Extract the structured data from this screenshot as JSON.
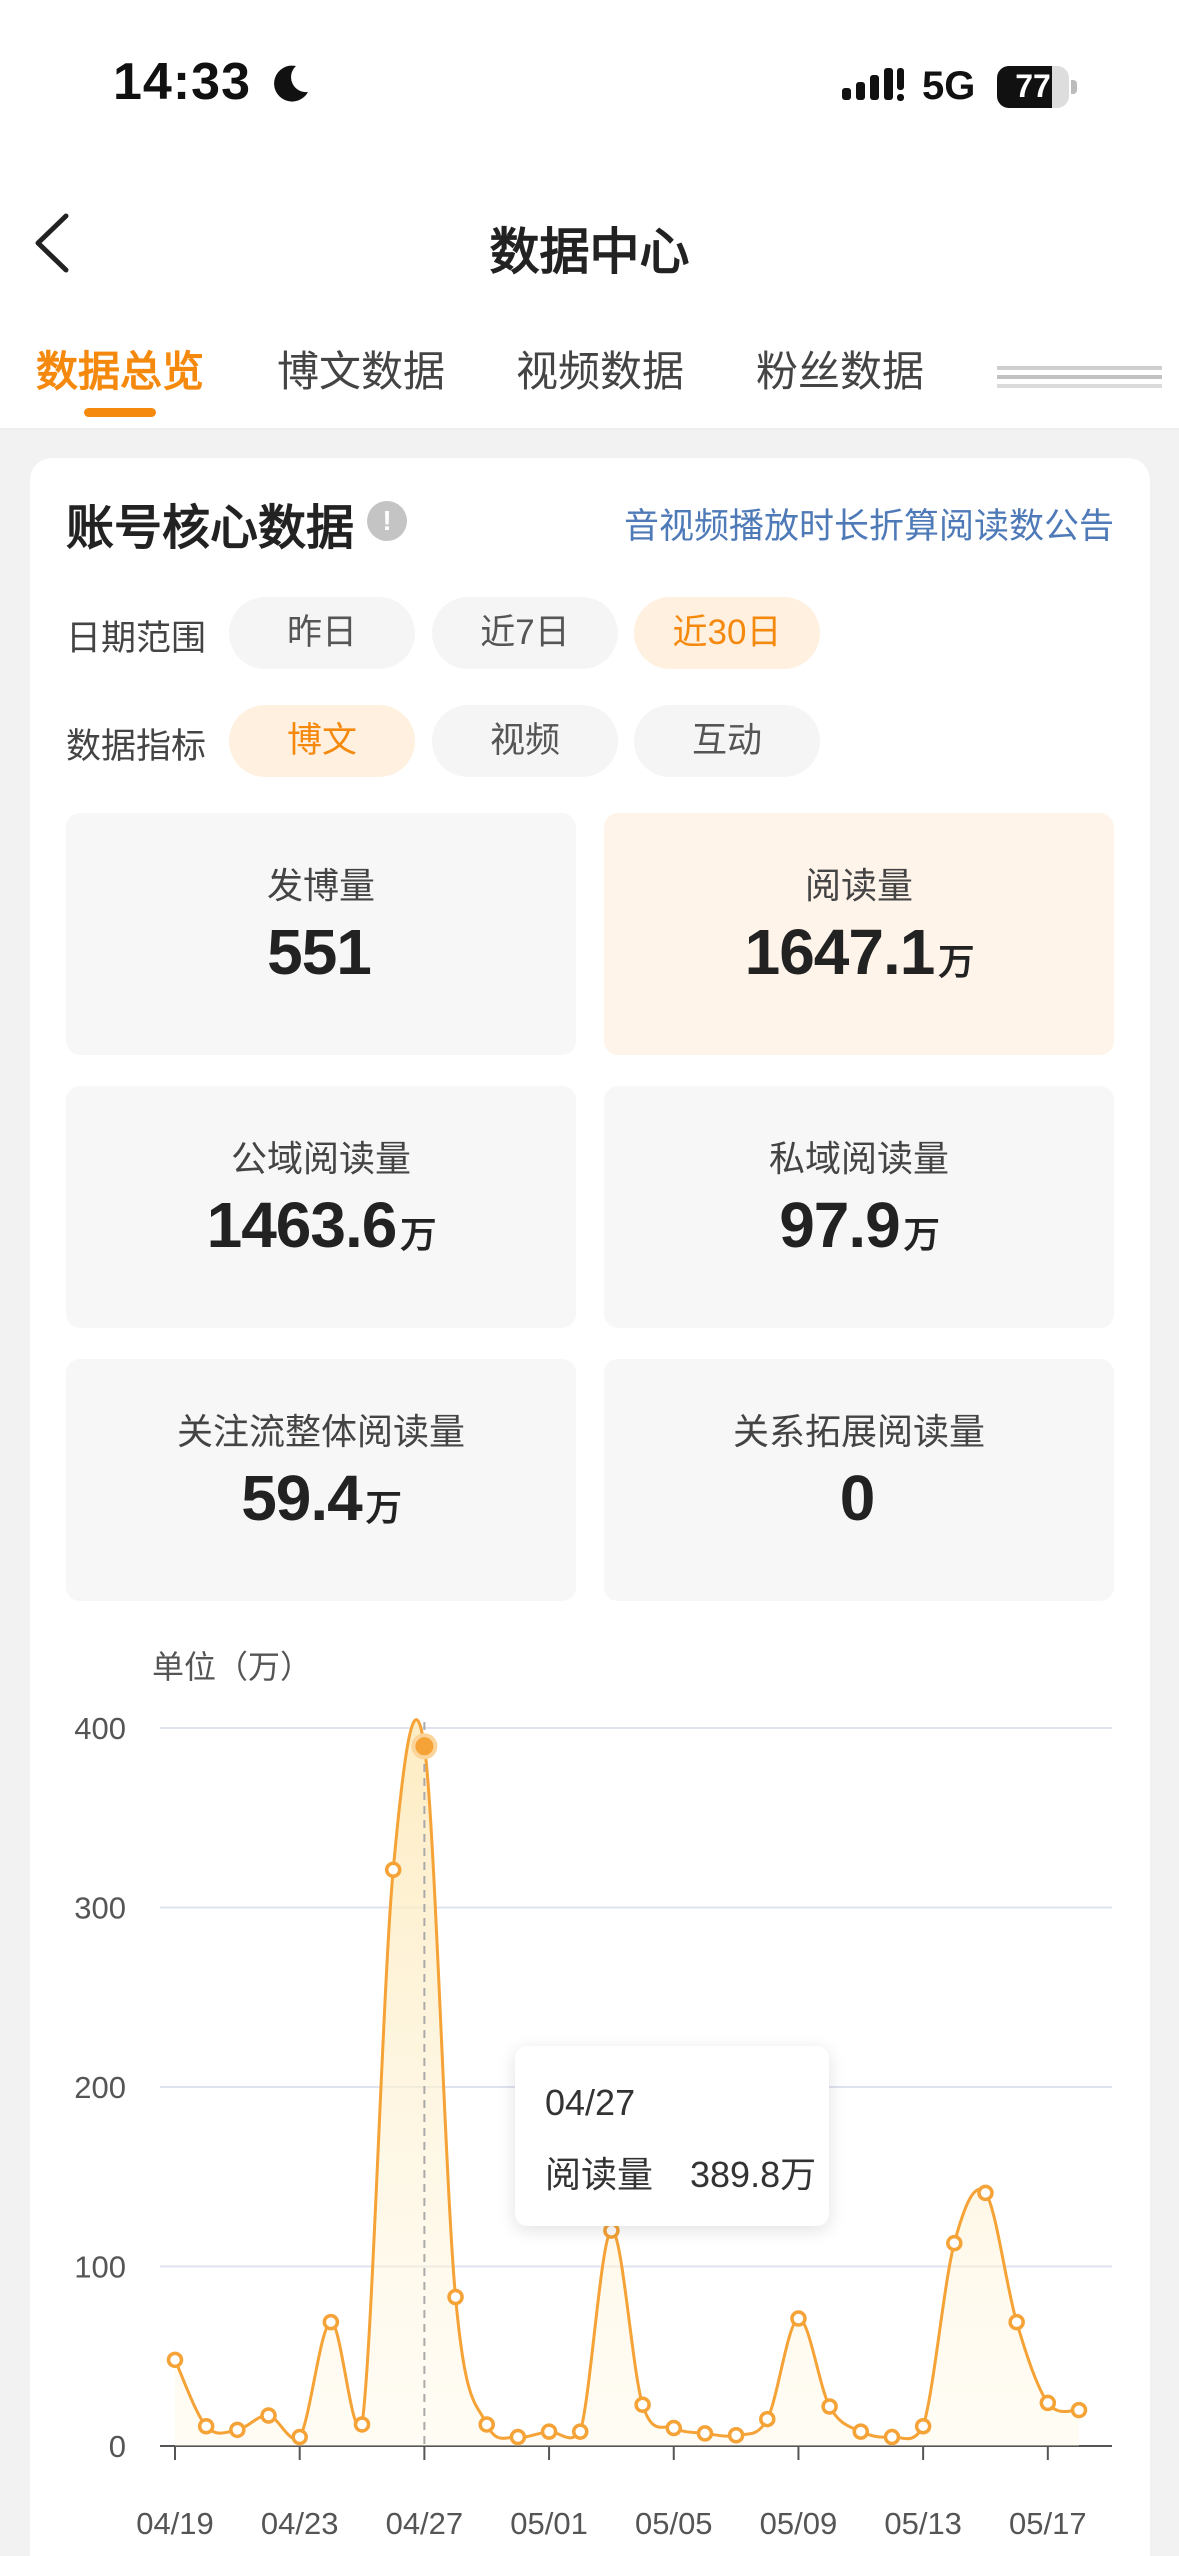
{
  "status_bar": {
    "time": "14:33",
    "network": "5G",
    "battery": "77",
    "battery_level": 0.77,
    "icons": [
      "moon-icon",
      "signal-icon",
      "battery-icon"
    ]
  },
  "nav": {
    "title": "数据中心",
    "back_icon": "chevron-left-icon"
  },
  "tabs": [
    {
      "label": "数据总览",
      "active": true
    },
    {
      "label": "博文数据",
      "active": false
    },
    {
      "label": "视频数据",
      "active": false
    },
    {
      "label": "粉丝数据",
      "active": false
    }
  ],
  "section": {
    "title": "账号核心数据",
    "info_icon": "!",
    "notice_link": "音视频播放时长折算阅读数公告"
  },
  "filters": {
    "date_label": "日期范围",
    "date_options": [
      "昨日",
      "近7日",
      "近30日"
    ],
    "date_selected": "近30日",
    "metric_label": "数据指标",
    "metric_options": [
      "博文",
      "视频",
      "互动"
    ],
    "metric_selected": "博文"
  },
  "metrics": [
    {
      "label": "发博量",
      "value": "551",
      "unit": "",
      "highlighted": false
    },
    {
      "label": "阅读量",
      "value": "1647.1",
      "unit": "万",
      "highlighted": true
    },
    {
      "label": "公域阅读量",
      "value": "1463.6",
      "unit": "万",
      "highlighted": false
    },
    {
      "label": "私域阅读量",
      "value": "97.9",
      "unit": "万",
      "highlighted": false
    },
    {
      "label": "关注流整体阅读量",
      "value": "59.4",
      "unit": "万",
      "highlighted": false
    },
    {
      "label": "关系拓展阅读量",
      "value": "0",
      "unit": "",
      "highlighted": false
    }
  ],
  "chart_data": {
    "type": "area",
    "unit_label": "单位（万）",
    "ylim": [
      0,
      400
    ],
    "yticks": [
      0,
      100,
      200,
      300,
      400
    ],
    "x_tick_labels": [
      "04/19",
      "04/23",
      "04/27",
      "05/01",
      "05/05",
      "05/09",
      "05/13",
      "05/17"
    ],
    "x": [
      "04/19",
      "04/20",
      "04/21",
      "04/22",
      "04/23",
      "04/24",
      "04/25",
      "04/26",
      "04/27",
      "04/28",
      "04/29",
      "04/30",
      "05/01",
      "05/02",
      "05/03",
      "05/04",
      "05/05",
      "05/06",
      "05/07",
      "05/08",
      "05/09",
      "05/10",
      "05/11",
      "05/12",
      "05/13",
      "05/14",
      "05/15",
      "05/16",
      "05/17",
      "05/18"
    ],
    "series": [
      {
        "name": "阅读量",
        "color": "#f5a236",
        "values": [
          48,
          11,
          9,
          17,
          5,
          69,
          12,
          321,
          389.8,
          83,
          12,
          5,
          8,
          8,
          120,
          23,
          10,
          7,
          6,
          15,
          71,
          22,
          8,
          5,
          11,
          113,
          141,
          69,
          24,
          20
        ]
      }
    ],
    "grid": true,
    "tooltip": {
      "date": "04/27",
      "label": "阅读量",
      "value": "389.8万"
    }
  }
}
